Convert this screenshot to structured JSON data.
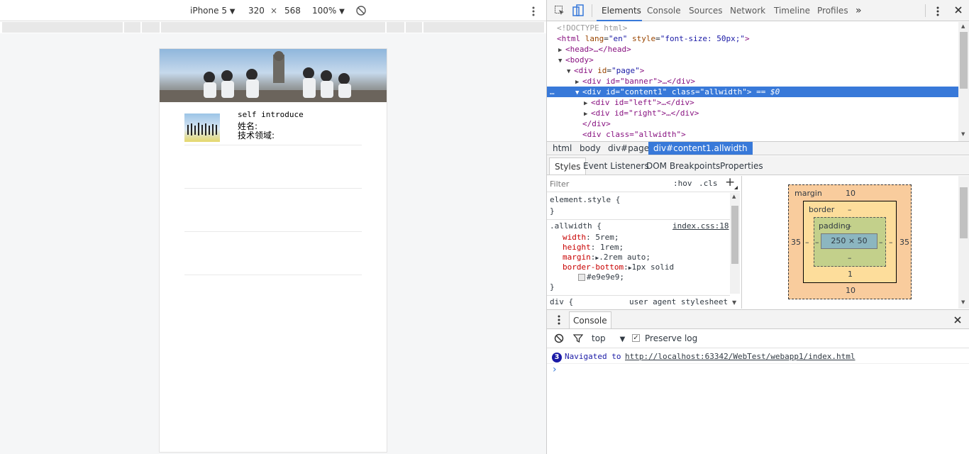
{
  "device_toolbar": {
    "device": "iPhone 5",
    "width": "320",
    "times": "×",
    "height": "568",
    "zoom": "100%"
  },
  "mobile_page": {
    "intro": "self introduce",
    "name_label": "姓名:",
    "field_label": "技术领域:"
  },
  "devtools": {
    "tabs": [
      "Elements",
      "Console",
      "Sources",
      "Network",
      "Timeline",
      "Profiles"
    ],
    "more_tabs": "»",
    "dom_tree": {
      "doctype": "<!DOCTYPE html>",
      "html_open": "<html",
      "html_lang_attr": "lang",
      "html_lang_val": "\"en\"",
      "html_style_attr": "style",
      "html_style_val": "\"font-size: 50px;\"",
      "html_close": ">",
      "head": "<head>…</head>",
      "body": "<body>",
      "page_open": "<div",
      "page_attr": "id",
      "page_val": "\"page\"",
      "banner": "<div id=\"banner\">…</div>",
      "content_div": "<div",
      "content_id_attr": "id",
      "content_id_val": "\"content1\"",
      "content_class_attr": "class",
      "content_class_val": "\"allwidth\"",
      "content_close": ">",
      "content_eq": "== $0",
      "dots": "…",
      "left": "<div id=\"left\">…</div>",
      "right": "<div id=\"right\">…</div>",
      "div_close": "</div>",
      "allwidth_div": "<div class=\"allwidth\">"
    },
    "breadcrumb": [
      "html",
      "body",
      "div#page",
      "div#content1.allwidth"
    ],
    "styles_tabs": [
      "Styles",
      "Event Listeners",
      "DOM Breakpoints",
      "Properties"
    ],
    "filter_placeholder": "Filter",
    "hov": ":hov",
    "cls": ".cls",
    "plus": "+",
    "element_style": "element.style {",
    "brace_close": "}",
    "rule_selector": ".allwidth {",
    "rule_source": "index.css:18",
    "declarations": [
      {
        "prop": "width",
        "value": "5rem;"
      },
      {
        "prop": "height",
        "value": "1rem;"
      },
      {
        "prop": "margin",
        "value": ".2rem auto;"
      },
      {
        "prop": "border-bottom",
        "value": "1px solid"
      }
    ],
    "border_color": "#e9e9e9;",
    "ua_selector": "div {",
    "ua_source": "user agent stylesheet",
    "box_model": {
      "margin_label": "margin",
      "margin_top": "10",
      "margin_bottom": "10",
      "margin_left": "35",
      "margin_right": "35",
      "border_label": "border",
      "border_top": "–",
      "border_bottom": "1",
      "border_left": "–",
      "border_right": "–",
      "padding_label": "padding",
      "padding_top": "–",
      "padding_bottom": "–",
      "padding_left": "–",
      "padding_right": "–",
      "content": "250 × 50"
    },
    "console": {
      "tab": "Console",
      "context": "top",
      "preserve_log": "Preserve log",
      "preserve_checked": true,
      "badge": "3",
      "message_prefix": "Navigated to",
      "message_url": "http://localhost:63342/WebTest/webapp1/index.html",
      "prompt": "›"
    }
  },
  "colors": {
    "accent": "#3879d9",
    "margin_box": "#f9cc9d",
    "border_box": "#fddd9b",
    "padding_box": "#c3d08b",
    "content_box": "#8cb6c0"
  }
}
